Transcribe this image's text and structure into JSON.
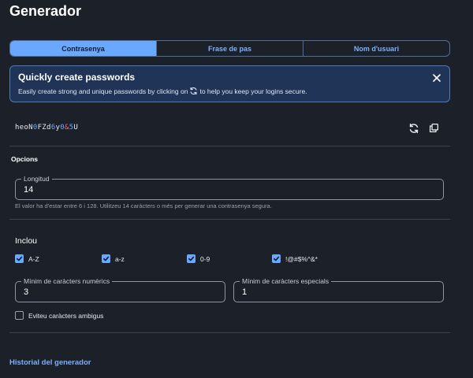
{
  "page": {
    "title": "Generador"
  },
  "tabs": [
    {
      "label": "Contrasenya",
      "active": true
    },
    {
      "label": "Frase de pas",
      "active": false
    },
    {
      "label": "Nom d'usuari",
      "active": false
    }
  ],
  "banner": {
    "title": "Quickly create passwords",
    "text_before": "Easily create strong and unique passwords by clicking on",
    "text_after": "to help you keep your logins secure.",
    "inline_icon": "regenerate-icon",
    "close_icon": "close-icon"
  },
  "password": {
    "segments": [
      {
        "text": "heoN",
        "type": "letter"
      },
      {
        "text": "0",
        "type": "number"
      },
      {
        "text": "FZd",
        "type": "letter"
      },
      {
        "text": "6",
        "type": "number"
      },
      {
        "text": "y",
        "type": "letter"
      },
      {
        "text": "0",
        "type": "number"
      },
      {
        "text": "&",
        "type": "special"
      },
      {
        "text": "5",
        "type": "number"
      },
      {
        "text": "U",
        "type": "letter"
      }
    ],
    "actions": [
      "regenerate-icon",
      "copy-icon"
    ]
  },
  "options": {
    "heading": "Opcions",
    "length": {
      "label": "Longitud",
      "value": "14",
      "hint": "El valor ha d'estar entre 6 i 128. Utilitzeu 14 caràcters o més per generar una contrasenya segura."
    },
    "include": {
      "heading": "Inclou",
      "checkboxes": [
        {
          "label": "A-Z",
          "checked": true
        },
        {
          "label": "a-z",
          "checked": true
        },
        {
          "label": "0-9",
          "checked": true
        },
        {
          "label": "!@#$%^&*",
          "checked": true
        }
      ]
    },
    "min_numbers": {
      "label": "Mínim de caràcters numèrics",
      "value": "3"
    },
    "min_special": {
      "label": "Mínim de caràcters especials",
      "value": "1"
    },
    "avoid_ambiguous": {
      "label": "Eviteu caràcters ambigus",
      "checked": false
    }
  },
  "history_link": {
    "label": "Historial del generador"
  },
  "colors": {
    "background": "#1b2029",
    "accent": "#6aa8ff",
    "number_char": "#6aa8ff",
    "special_char": "#ff6b7a",
    "banner_bg": "#1f3457"
  }
}
